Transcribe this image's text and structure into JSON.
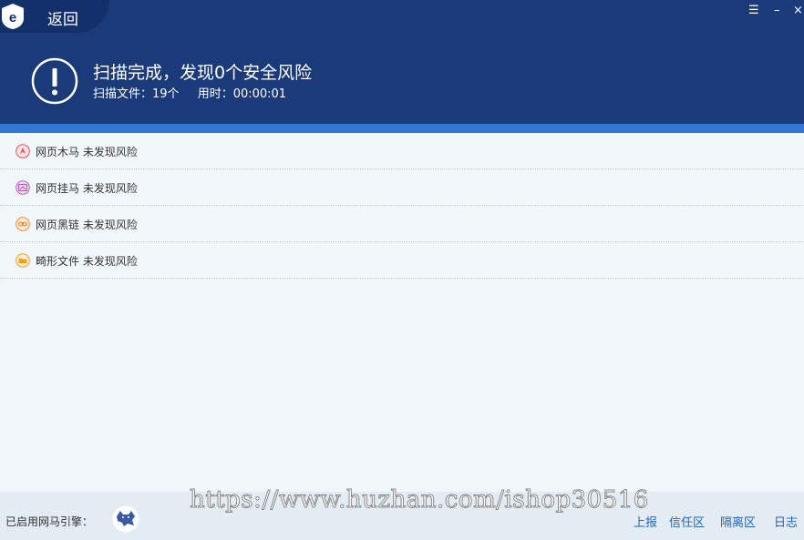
{
  "header": {
    "back_label": "返回",
    "title": "扫描完成，发现0个安全风险",
    "files_scanned": "扫描文件：19个",
    "elapsed": "用时：00:00:01"
  },
  "window_controls": {
    "menu": "☰",
    "minimize": "–",
    "close": "×"
  },
  "results": [
    {
      "icon": "trojan-icon",
      "color": "#e0505a",
      "label": "网页木马 未发现风险"
    },
    {
      "icon": "hang-horse-icon",
      "color": "#b060c0",
      "label": "网页挂马 未发现风险"
    },
    {
      "icon": "dark-link-icon",
      "color": "#f08a30",
      "label": "网页黑链 未发现风险"
    },
    {
      "icon": "deformed-file-icon",
      "color": "#f0a020",
      "label": "畸形文件 未发现风险"
    }
  ],
  "footer": {
    "engine_label": "已启用网马引擎：",
    "watermark": "https://www.huzhan.com/ishop30516",
    "links": {
      "report": "上报",
      "trust_zone": "信任区",
      "quarantine": "隔离区",
      "log": "日志"
    }
  },
  "colors": {
    "header_bg": "#1a3a7a",
    "accent_bar": "#3178d6",
    "link": "#2266bb",
    "content_bg": "#f2f7fc"
  }
}
